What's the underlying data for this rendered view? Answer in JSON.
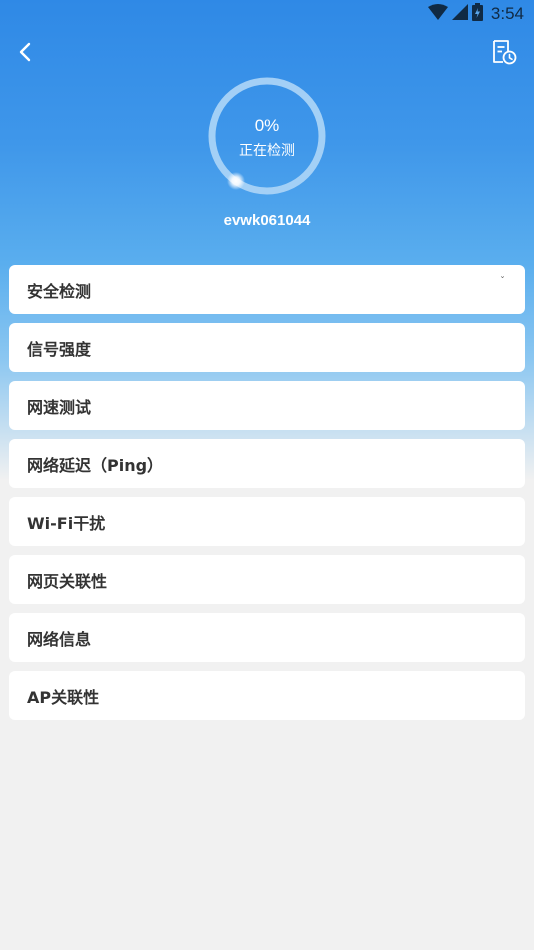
{
  "status_bar": {
    "time": "3:54"
  },
  "header": {
    "progress_percent": "0%",
    "status_text": "正在检测",
    "device_name": "evwk061044",
    "progress": 0
  },
  "items": [
    {
      "label": "安全检测",
      "indicator": "ˇ"
    },
    {
      "label": "信号强度"
    },
    {
      "label": "网速测试"
    },
    {
      "label": "网络延迟（Ping）"
    },
    {
      "label": "Wi-Fi干扰"
    },
    {
      "label": "网页关联性"
    },
    {
      "label": "网络信息"
    },
    {
      "label": "AP关联性"
    }
  ],
  "colors": {
    "header_top": "#2f89e6",
    "ring": "#a9d3f7",
    "background": "#f1f1f1"
  },
  "icons": [
    "wifi-icon",
    "cellular-signal-icon",
    "battery-icon",
    "back-arrow-icon",
    "history-report-icon"
  ]
}
